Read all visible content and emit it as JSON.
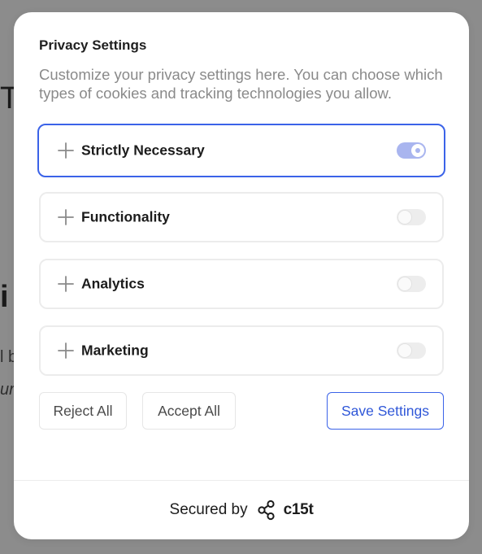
{
  "background": {
    "fragments": [
      "T",
      "i",
      "l b",
      "ur"
    ]
  },
  "dialog": {
    "title": "Privacy Settings",
    "description": "Customize your privacy settings here. You can choose which types of cookies and tracking technologies you allow.",
    "categories": [
      {
        "label": "Strictly Necessary",
        "enabled": true,
        "focused": true
      },
      {
        "label": "Functionality",
        "enabled": false
      },
      {
        "label": "Analytics",
        "enabled": false
      },
      {
        "label": "Marketing",
        "enabled": false
      }
    ],
    "buttons": {
      "reject_all": "Reject All",
      "accept_all": "Accept All",
      "save_settings": "Save Settings"
    },
    "footer": {
      "secured_by": "Secured by",
      "brand": "c15t",
      "brand_icon": "share-nodes-icon"
    }
  },
  "colors": {
    "accent": "#3b63e8",
    "toggle_on": "#a9b5ef",
    "toggle_off": "#ededed",
    "overlay": "#8c8c8c"
  }
}
